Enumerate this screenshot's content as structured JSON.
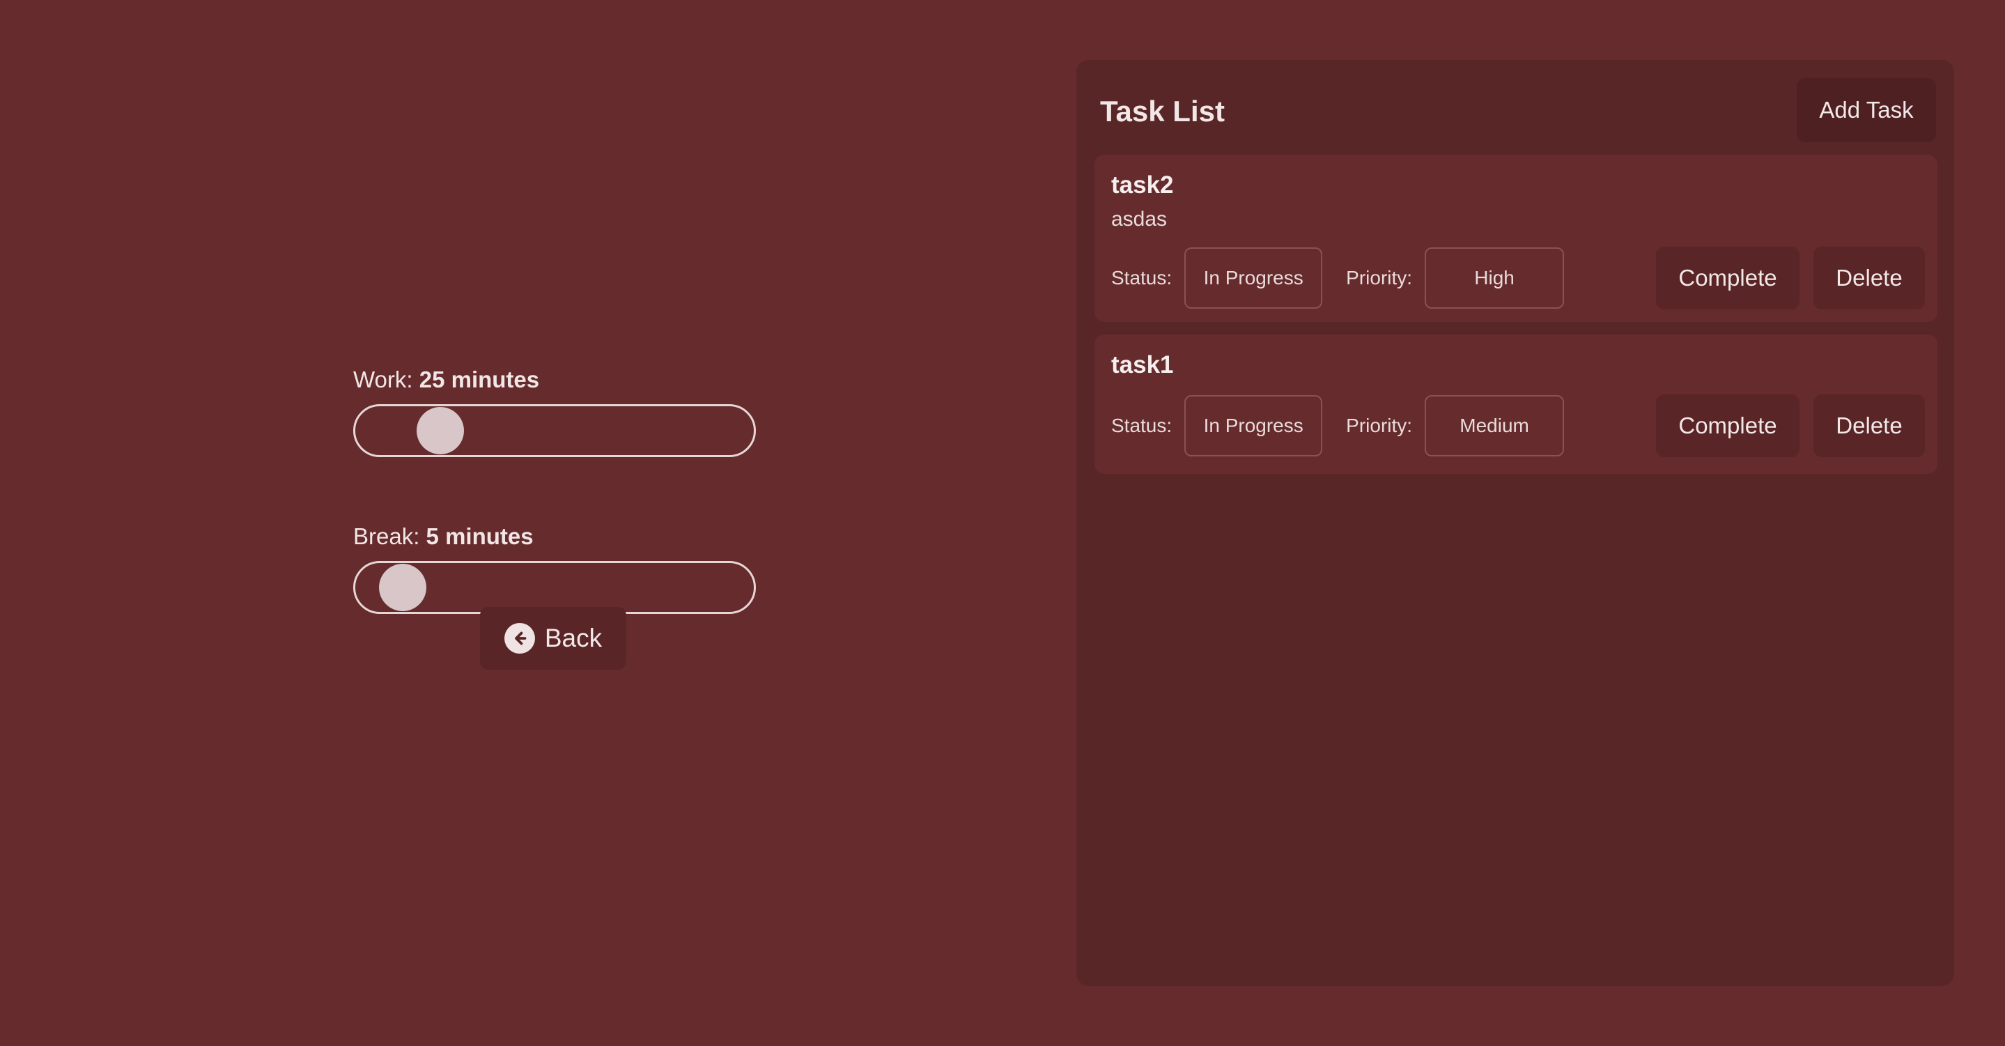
{
  "timer": {
    "work": {
      "label_prefix": "Work:",
      "value_text": "25 minutes",
      "value": 25,
      "min": 5,
      "max": 120
    },
    "break": {
      "label_prefix": "Break:",
      "value_text": "5 minutes",
      "value": 5,
      "min": 1,
      "max": 60
    },
    "back_label": "Back"
  },
  "tasks_panel": {
    "title": "Task List",
    "add_task_label": "Add Task",
    "status_label": "Status:",
    "priority_label": "Priority:",
    "complete_label": "Complete",
    "delete_label": "Delete",
    "tasks": [
      {
        "name": "task2",
        "description": "asdas",
        "status": "In Progress",
        "priority": "High"
      },
      {
        "name": "task1",
        "description": "",
        "status": "In Progress",
        "priority": "Medium"
      }
    ]
  }
}
